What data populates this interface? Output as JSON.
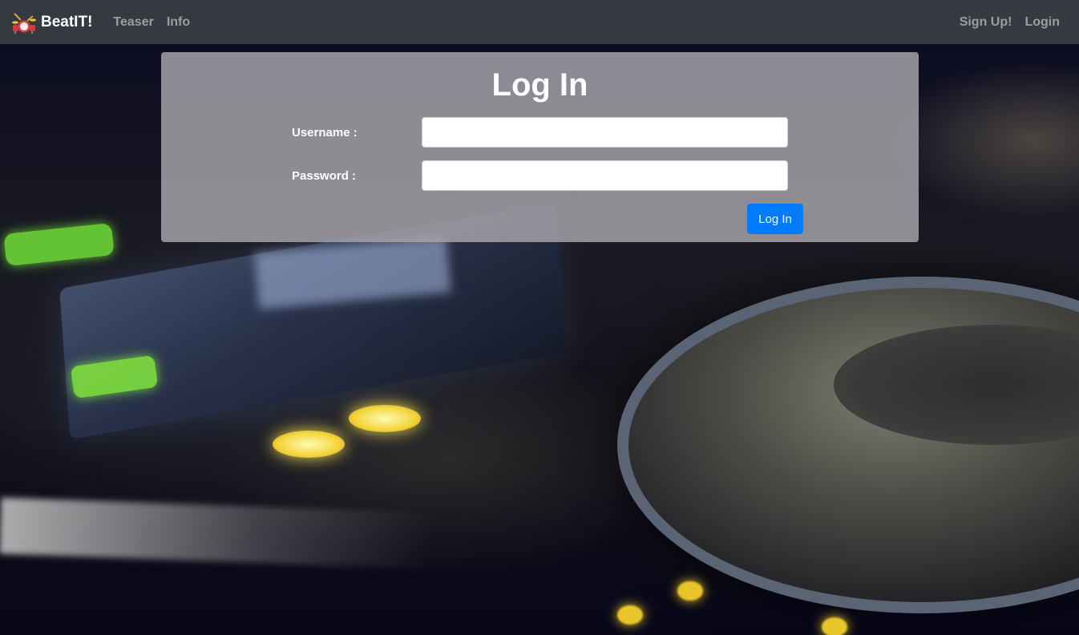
{
  "navbar": {
    "brand": "BeatIT!",
    "left_links": [
      "Teaser",
      "Info"
    ],
    "right_links": [
      "Sign Up!",
      "Login"
    ],
    "background_color": "#343a40"
  },
  "login_form": {
    "title": "Log In",
    "username_label": "Username :",
    "username_value": "",
    "password_label": "Password :",
    "password_value": "",
    "submit_label": "Log In",
    "accent_color": "#007bff"
  },
  "icons": {
    "brand_logo": "drum-kit-icon"
  }
}
